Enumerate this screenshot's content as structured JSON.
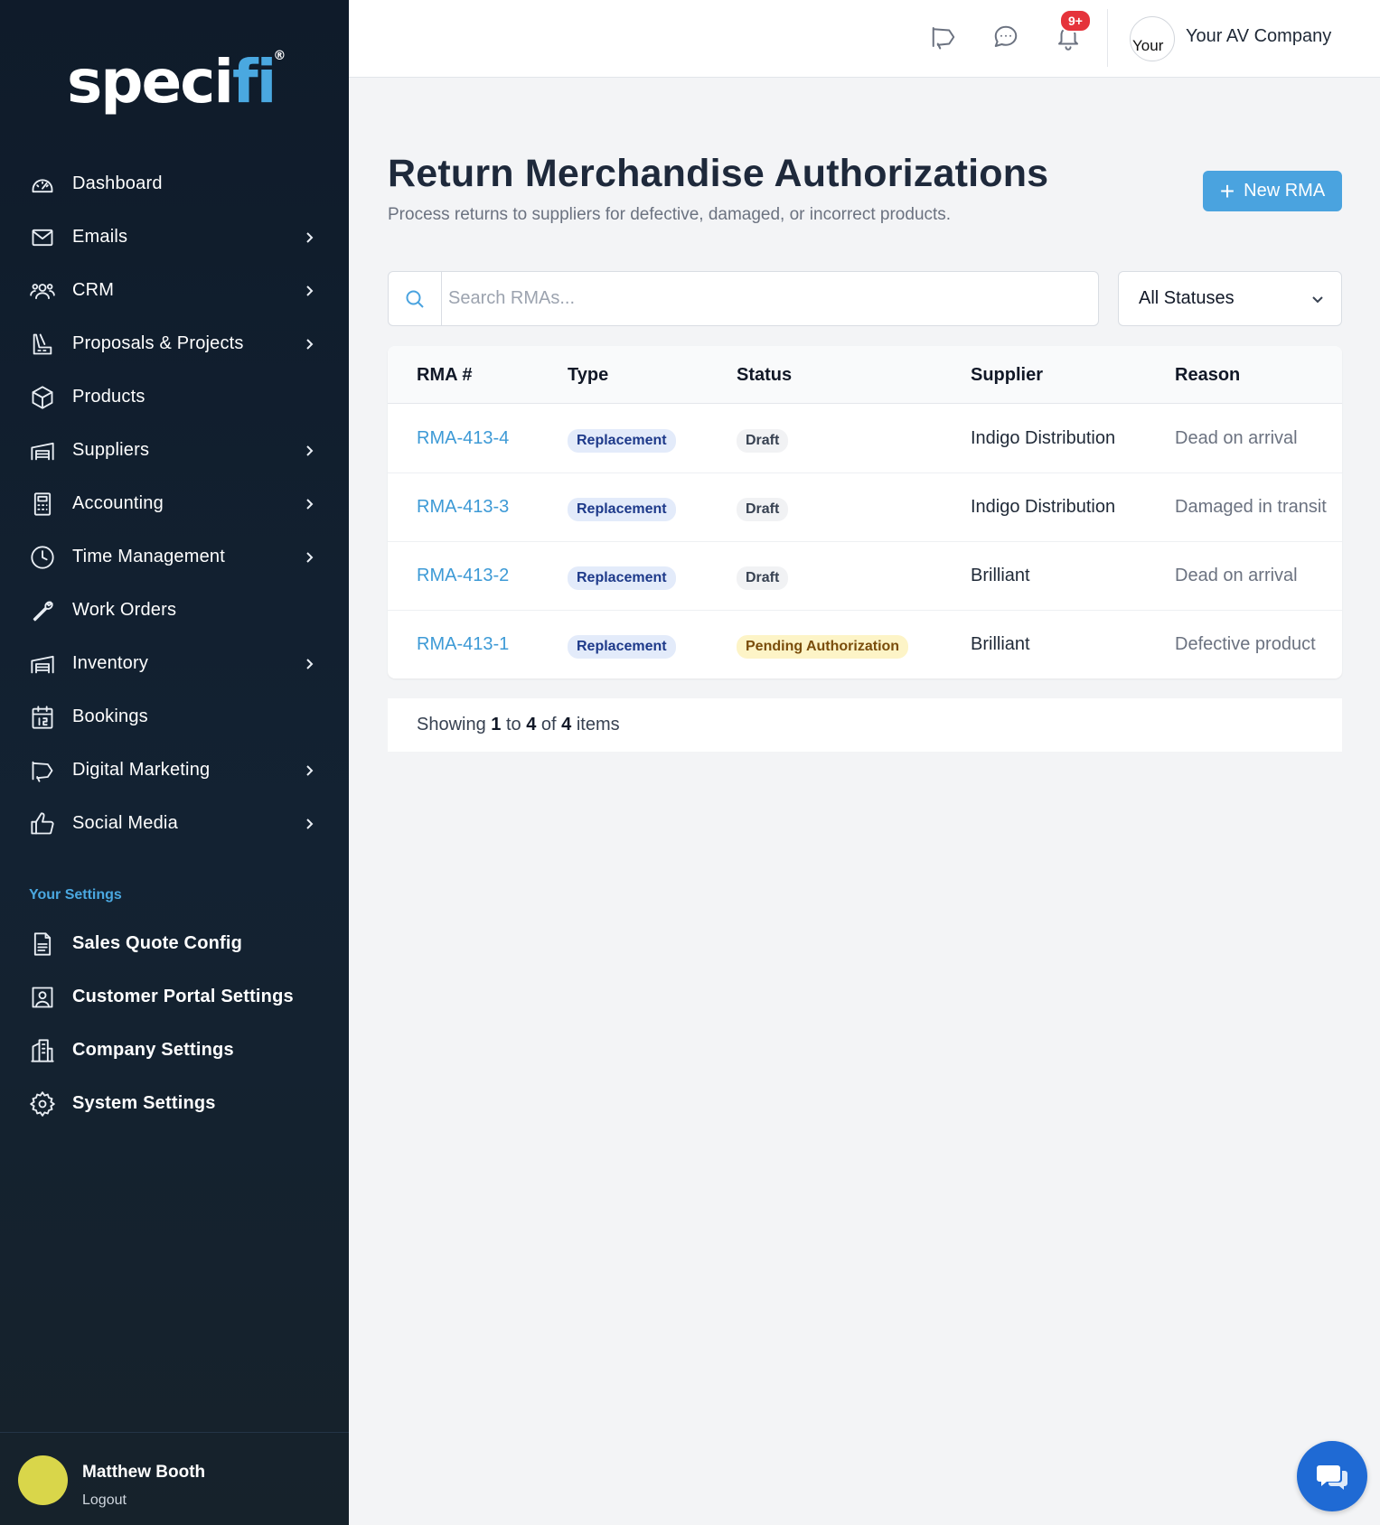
{
  "brand": {
    "logo_prefix": "speci",
    "logo_accent": "fi",
    "logo_mark": "®"
  },
  "sidebar": {
    "items": [
      {
        "label": "Dashboard",
        "icon": "gauge-icon",
        "chevron": false
      },
      {
        "label": "Emails",
        "icon": "envelope-icon",
        "chevron": true
      },
      {
        "label": "CRM",
        "icon": "users-icon",
        "chevron": true
      },
      {
        "label": "Proposals & Projects",
        "icon": "drafting-icon",
        "chevron": true
      },
      {
        "label": "Products",
        "icon": "box-icon",
        "chevron": false
      },
      {
        "label": "Suppliers",
        "icon": "warehouse-icon",
        "chevron": true
      },
      {
        "label": "Accounting",
        "icon": "calculator-icon",
        "chevron": true
      },
      {
        "label": "Time Management",
        "icon": "clock-icon",
        "chevron": true
      },
      {
        "label": "Work Orders",
        "icon": "wrench-icon",
        "chevron": false
      },
      {
        "label": "Inventory",
        "icon": "warehouse-icon",
        "chevron": true
      },
      {
        "label": "Bookings",
        "icon": "calendar-icon",
        "chevron": false
      },
      {
        "label": "Digital Marketing",
        "icon": "megaphone-icon",
        "chevron": true
      },
      {
        "label": "Social Media",
        "icon": "thumbs-up-icon",
        "chevron": true
      }
    ],
    "settings_title": "Your Settings",
    "settings_items": [
      {
        "label": "Sales Quote Config",
        "icon": "document-icon"
      },
      {
        "label": "Customer Portal Settings",
        "icon": "portrait-icon"
      },
      {
        "label": "Company Settings",
        "icon": "building-icon"
      },
      {
        "label": "System Settings",
        "icon": "gear-icon"
      }
    ],
    "user": {
      "name": "Matthew Booth",
      "logout": "Logout"
    }
  },
  "topbar": {
    "notification_badge": "9+",
    "company_avatar_alt": "Your",
    "company_name": "Your AV Company"
  },
  "page": {
    "title": "Return Merchandise Authorizations",
    "subtitle": "Process returns to suppliers for defective, damaged, or incorrect products.",
    "new_button": "New RMA",
    "new_button_icon": "+",
    "search_placeholder": "Search RMAs...",
    "status_filter": "All Statuses"
  },
  "table": {
    "headers": {
      "rma": "RMA #",
      "type": "Type",
      "status": "Status",
      "supplier": "Supplier",
      "reason": "Reason"
    },
    "rows": [
      {
        "rma": "RMA-413-4",
        "type": "Replacement",
        "status": "Draft",
        "status_kind": "draft",
        "supplier": "Indigo Distribution",
        "reason": "Dead on arrival"
      },
      {
        "rma": "RMA-413-3",
        "type": "Replacement",
        "status": "Draft",
        "status_kind": "draft",
        "supplier": "Indigo Distribution",
        "reason": "Damaged in transit"
      },
      {
        "rma": "RMA-413-2",
        "type": "Replacement",
        "status": "Draft",
        "status_kind": "draft",
        "supplier": "Brilliant",
        "reason": "Dead on arrival"
      },
      {
        "rma": "RMA-413-1",
        "type": "Replacement",
        "status": "Pending Authorization",
        "status_kind": "pending",
        "supplier": "Brilliant",
        "reason": "Defective product"
      }
    ]
  },
  "pagination": {
    "prefix": "Showing",
    "from": "1",
    "to_word": "to",
    "to": "4",
    "of_word": "of",
    "total": "4",
    "suffix": "items"
  },
  "colors": {
    "accent": "#4aa3df",
    "sidebar_bg": "#0f1b2a",
    "badge": "#e5333b",
    "chat": "#1f6ad4"
  }
}
